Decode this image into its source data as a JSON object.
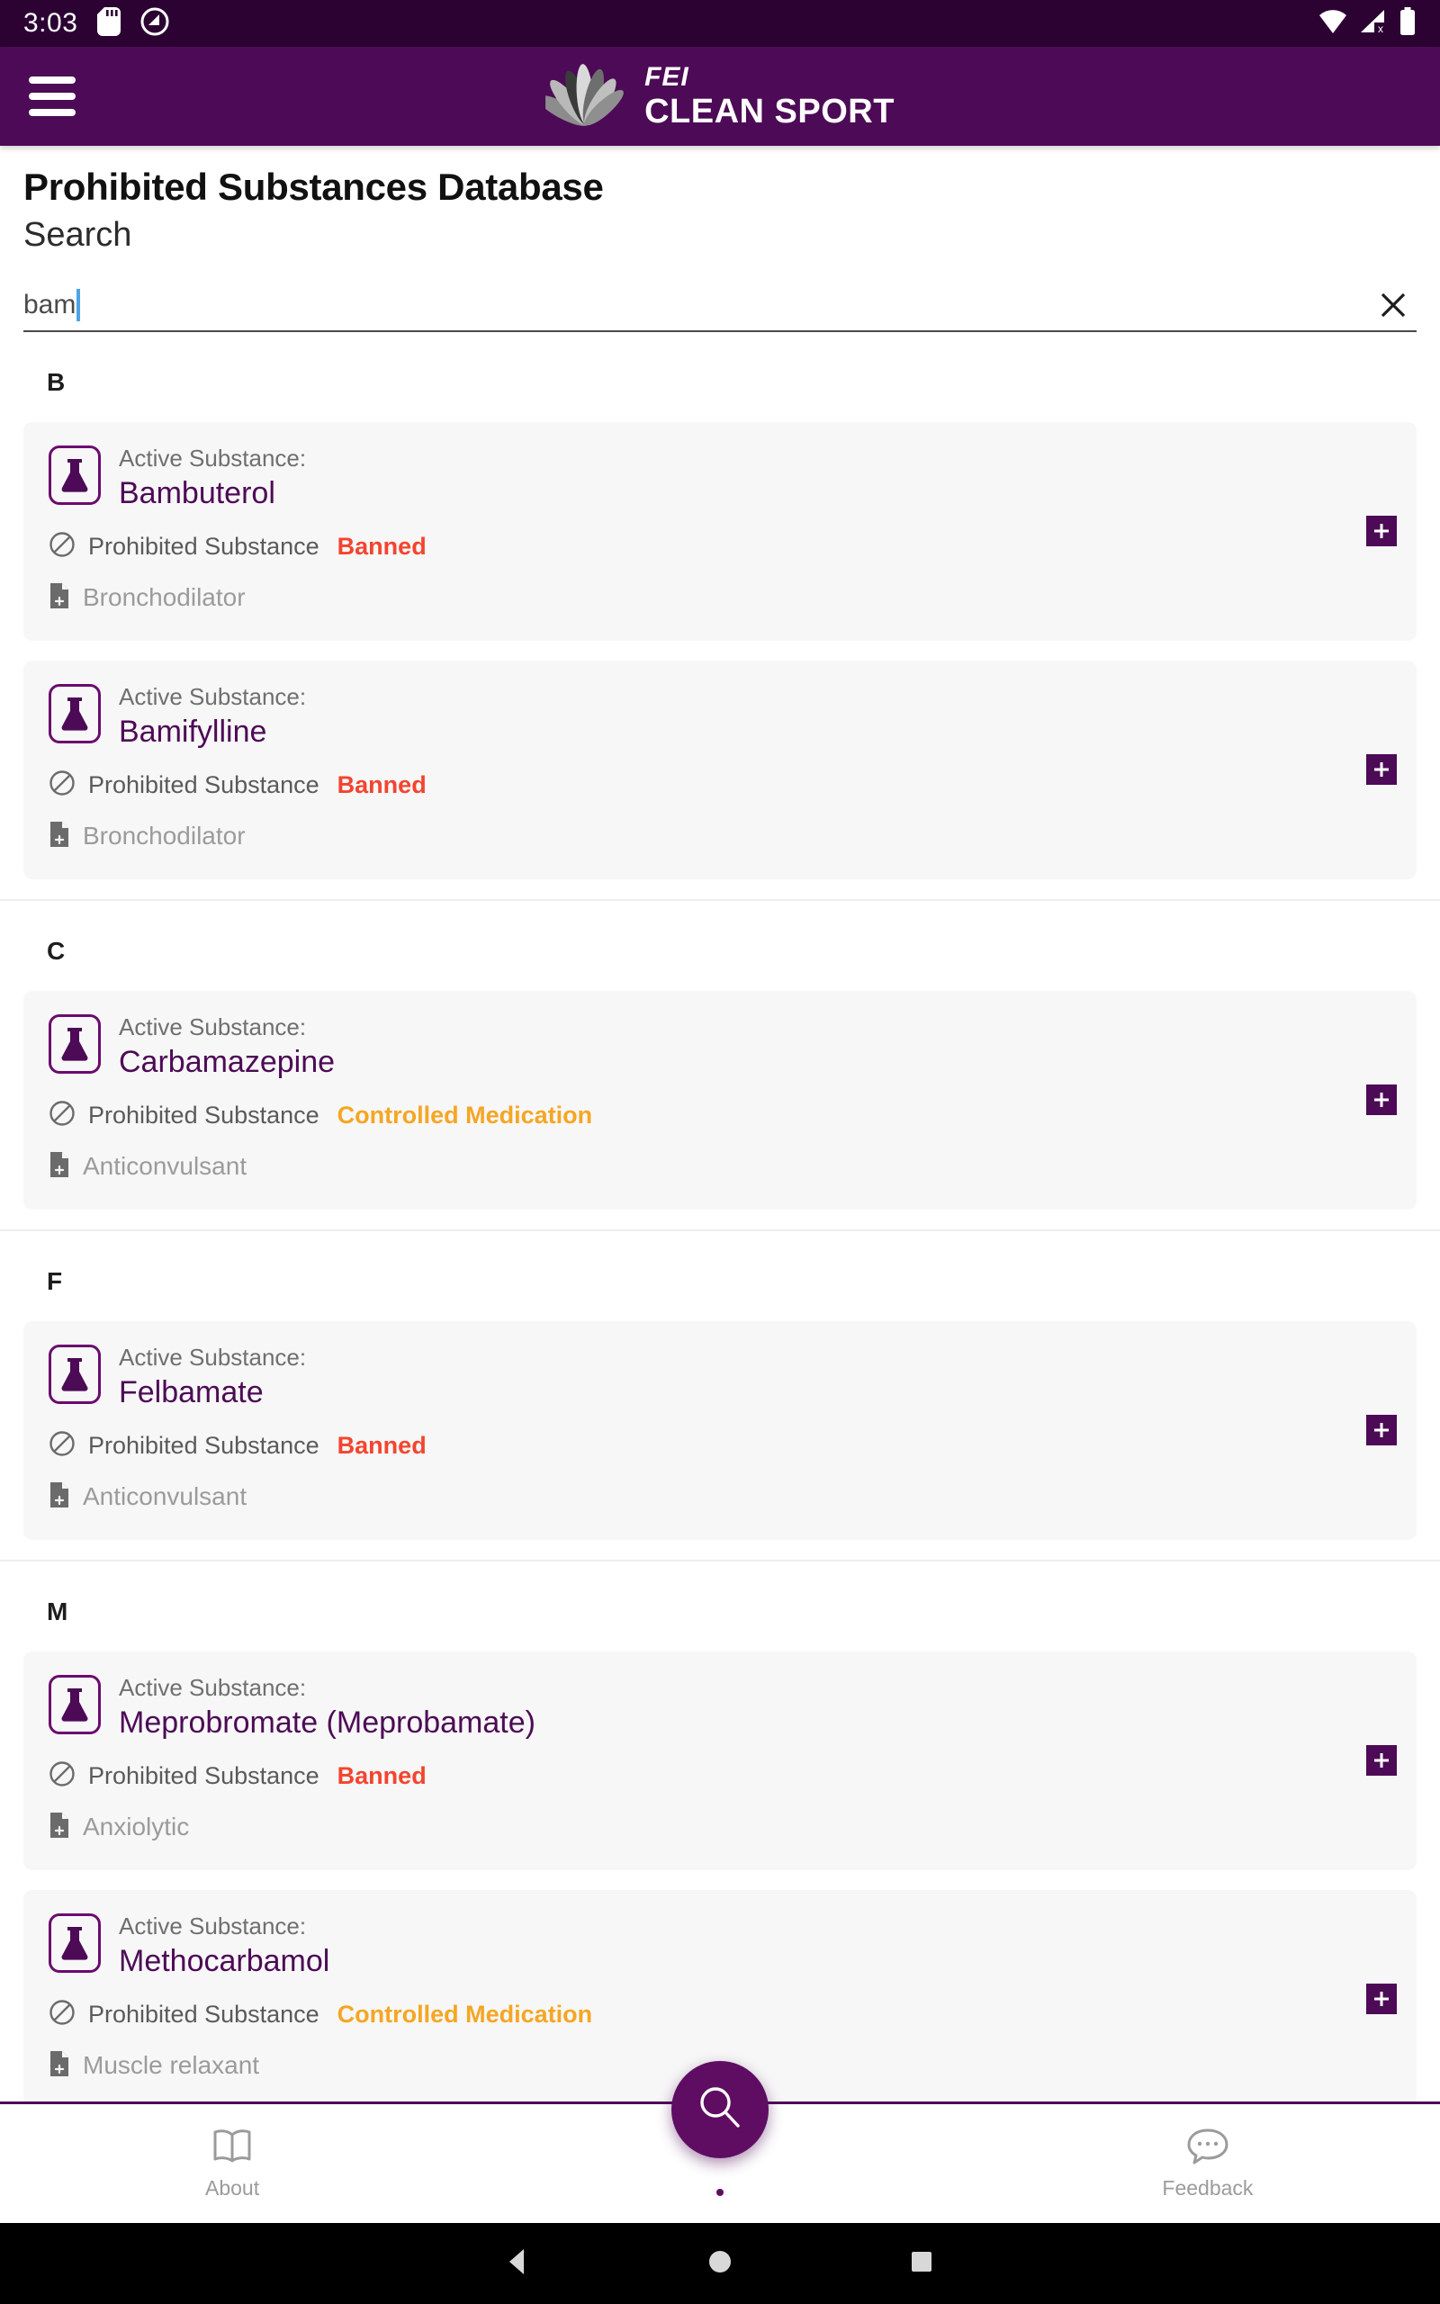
{
  "statusbar": {
    "time": "3:03",
    "icons": [
      "sd-card-icon",
      "do-not-disturb-icon",
      "wifi-icon",
      "cellular-no-sim-icon",
      "battery-full-icon"
    ]
  },
  "appbar": {
    "menu_icon": "hamburger-menu-icon",
    "logo_icon": "fei-petals-logo-icon",
    "brand_line1": "FEI",
    "brand_line2": "CLEAN SPORT"
  },
  "page": {
    "title": "Prohibited Substances Database",
    "subtitle": "Search"
  },
  "search": {
    "value": "bam",
    "placeholder": "",
    "clear_icon": "close-icon"
  },
  "labels": {
    "active_substance": "Active Substance:",
    "prohibited_substance": "Prohibited Substance",
    "flask_icon": "flask-icon",
    "prohibited_icon": "no-entry-icon",
    "category_icon": "document-add-icon",
    "add_icon": "plus-icon"
  },
  "colors": {
    "appbar_purple": "#4d0a56",
    "statusbar_purple": "#2c0233",
    "accent_purple": "#6b0a6f",
    "banned_red": "#f4442e",
    "controlled_orange": "#f5a623",
    "card_bg": "#f7f7f7",
    "caret_blue": "#4da3e8"
  },
  "sections": [
    {
      "letter": "B",
      "items": [
        {
          "name": "Bambuterol",
          "status": "Banned",
          "status_type": "banned",
          "category": "Bronchodilator"
        },
        {
          "name": "Bamifylline",
          "status": "Banned",
          "status_type": "banned",
          "category": "Bronchodilator"
        }
      ]
    },
    {
      "letter": "C",
      "items": [
        {
          "name": "Carbamazepine",
          "status": "Controlled Medication",
          "status_type": "controlled",
          "category": "Anticonvulsant"
        }
      ]
    },
    {
      "letter": "F",
      "items": [
        {
          "name": "Felbamate",
          "status": "Banned",
          "status_type": "banned",
          "category": "Anticonvulsant"
        }
      ]
    },
    {
      "letter": "M",
      "items": [
        {
          "name": "Meprobromate (Meprobamate)",
          "status": "Banned",
          "status_type": "banned",
          "category": "Anxiolytic"
        },
        {
          "name": "Methocarbamol",
          "status": "Controlled Medication",
          "status_type": "controlled",
          "category": "Muscle relaxant"
        }
      ]
    }
  ],
  "bottomnav": {
    "items": [
      {
        "label": "About",
        "icon": "book-icon"
      },
      {
        "label": "Feedback",
        "icon": "chat-bubble-icon"
      }
    ],
    "fab_icon": "search-icon"
  },
  "sysnav": {
    "back": "back-triangle-icon",
    "home": "home-circle-icon",
    "recents": "recents-square-icon"
  }
}
